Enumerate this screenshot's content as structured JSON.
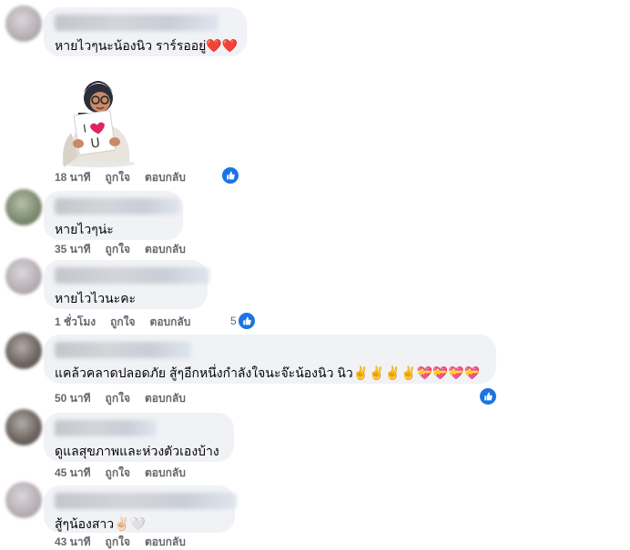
{
  "comments": [
    {
      "text": "หายไวๆนะน้องนิว ราร์รออยู่❤️❤️",
      "time": "18 นาที",
      "like": "ถูกใจ",
      "reply": "ตอบกลับ"
    },
    {
      "text": "หายไวๆน่ะ",
      "time": "35 นาที",
      "like": "ถูกใจ",
      "reply": "ตอบกลับ"
    },
    {
      "text": "หายไวไวนะคะ",
      "time": "1 ชั่วโมง",
      "like": "ถูกใจ",
      "reply": "ตอบกลับ",
      "reactions": "5"
    },
    {
      "text": "แคล้วคลาดปลอดภัย สู้ๆอีกหนึ่งกำลังใจนะจ๊ะน้องนิว นิว✌️✌️✌️✌️💝💝💝💝",
      "time": "50 นาที",
      "like": "ถูกใจ",
      "reply": "ตอบกลับ"
    },
    {
      "text": "ดูแลสุขภาพและห่วงตัวเองบ้าง",
      "time": "45 นาที",
      "like": "ถูกใจ",
      "reply": "ตอบกลับ"
    },
    {
      "text": "สู้ๆน้องสาว✌🏻🤍",
      "time": "43 นาที",
      "like": "ถูกใจ",
      "reply": "ตอบกลับ"
    }
  ],
  "sticker": {
    "sign_text": "I ❤ U"
  },
  "colors": {
    "like_blue": "#1b74e4",
    "bubble_bg": "#f0f2f5",
    "meta_gray": "#65676b"
  },
  "icons": {
    "like": "thumbs-up-icon"
  }
}
